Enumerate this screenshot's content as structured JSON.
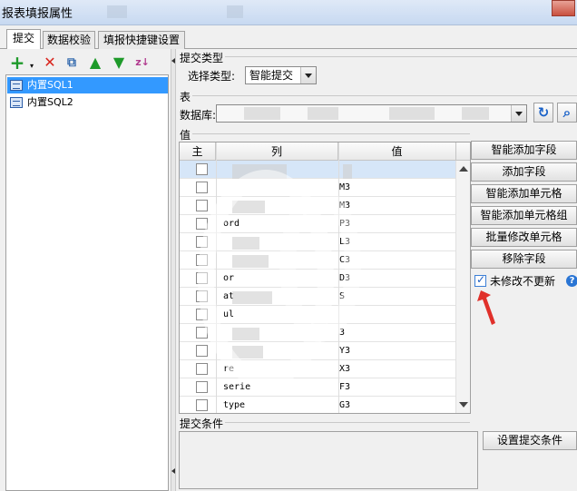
{
  "window": {
    "title": "报表填报属性"
  },
  "tabs": [
    {
      "label": "提交",
      "active": true
    },
    {
      "label": "数据校验",
      "active": false
    },
    {
      "label": "填报快捷键设置",
      "active": false
    }
  ],
  "toolbar": {
    "icons": [
      "add-icon",
      "delete-icon",
      "copy-icon",
      "move-up-icon",
      "move-down-icon",
      "sort-icon"
    ]
  },
  "tree": {
    "items": [
      {
        "label": "内置SQL1",
        "selected": true
      },
      {
        "label": "内置SQL2",
        "selected": false
      }
    ]
  },
  "submit_type": {
    "group_label": "提交类型",
    "label": "选择类型:",
    "value": "智能提交"
  },
  "table_group": {
    "group_label": "表",
    "db_label": "数据库:"
  },
  "values_group": {
    "group_label": "值",
    "columns": [
      "主",
      "列",
      "值"
    ],
    "rows": [
      {
        "col": "",
        "val": ""
      },
      {
        "col": "",
        "val": "M3"
      },
      {
        "col": "",
        "val": "M3"
      },
      {
        "col": "ord",
        "val": "P3"
      },
      {
        "col": "",
        "val": "L3"
      },
      {
        "col": "",
        "val": "C3"
      },
      {
        "col": "or",
        "val": "D3"
      },
      {
        "col": "at",
        "val": "S"
      },
      {
        "col": "ul",
        "val": ""
      },
      {
        "col": "",
        "val": "3"
      },
      {
        "col": "",
        "val": "Y3"
      },
      {
        "col": "re",
        "val": "X3"
      },
      {
        "col": "serie",
        "val": "F3"
      },
      {
        "col": "type",
        "val": "G3"
      }
    ]
  },
  "side_buttons": [
    "智能添加字段",
    "添加字段",
    "智能添加单元格",
    "智能添加单元格组",
    "批量修改单元格",
    "移除字段"
  ],
  "no_update": {
    "label": "未修改不更新",
    "checked": true
  },
  "submit_condition": {
    "group_label": "提交条件",
    "button_label": "设置提交条件"
  },
  "colors": {
    "accent": "#3399ff",
    "arrow": "#e0302a"
  }
}
